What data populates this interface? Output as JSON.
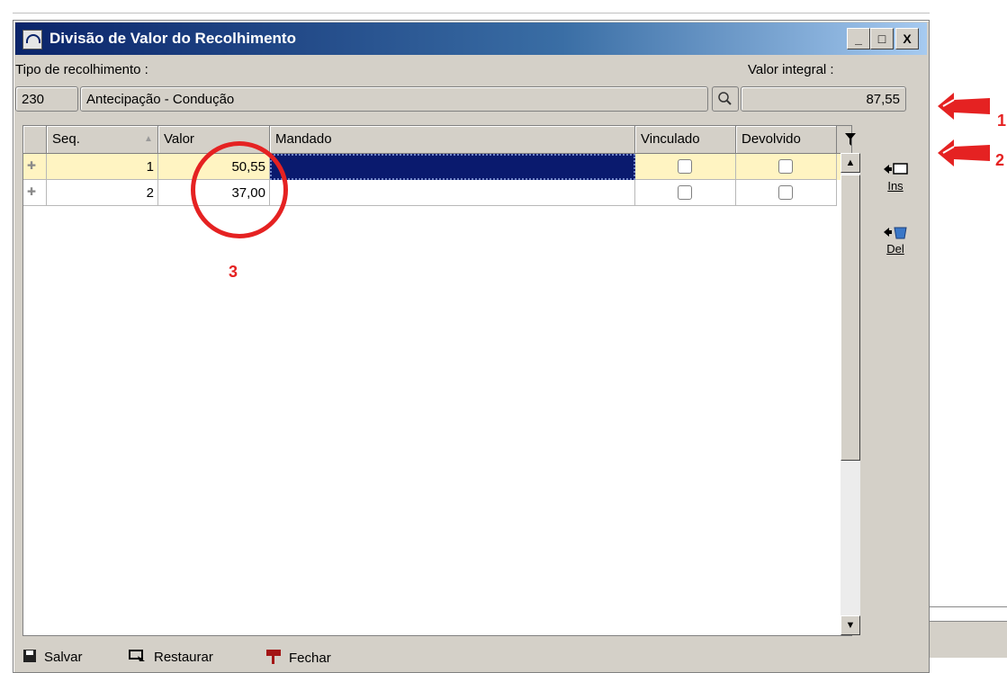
{
  "window": {
    "title": "Divisão de Valor do Recolhimento",
    "minimize": "_",
    "maximize": "□",
    "close": "X"
  },
  "form": {
    "tipo_label": "Tipo de recolhimento :",
    "tipo_code": "230",
    "tipo_desc": "Antecipação - Condução",
    "valor_label": "Valor integral :",
    "valor_value": "87,55"
  },
  "grid": {
    "columns": [
      "Seq.",
      "Valor",
      "Mandado",
      "Vinculado",
      "Devolvido"
    ],
    "rows": [
      {
        "seq": "1",
        "valor": "50,55",
        "mandado": "",
        "vinculado": false,
        "devolvido": false
      },
      {
        "seq": "2",
        "valor": "37,00",
        "mandado": "",
        "vinculado": false,
        "devolvido": false
      }
    ]
  },
  "side_buttons": {
    "ins": "Ins",
    "del": "Del"
  },
  "status": {
    "salvar": "Salvar",
    "restaurar": "Restaurar",
    "fechar": "Fechar"
  },
  "annotations": {
    "label_1": "1",
    "label_2": "2",
    "label_3": "3",
    "color": "#e52222"
  },
  "colors": {
    "title_start": "#0a246a",
    "title_end": "#a6caf0",
    "selected_row": "#fff4c2",
    "selected_cell": "#0a1a6e"
  }
}
